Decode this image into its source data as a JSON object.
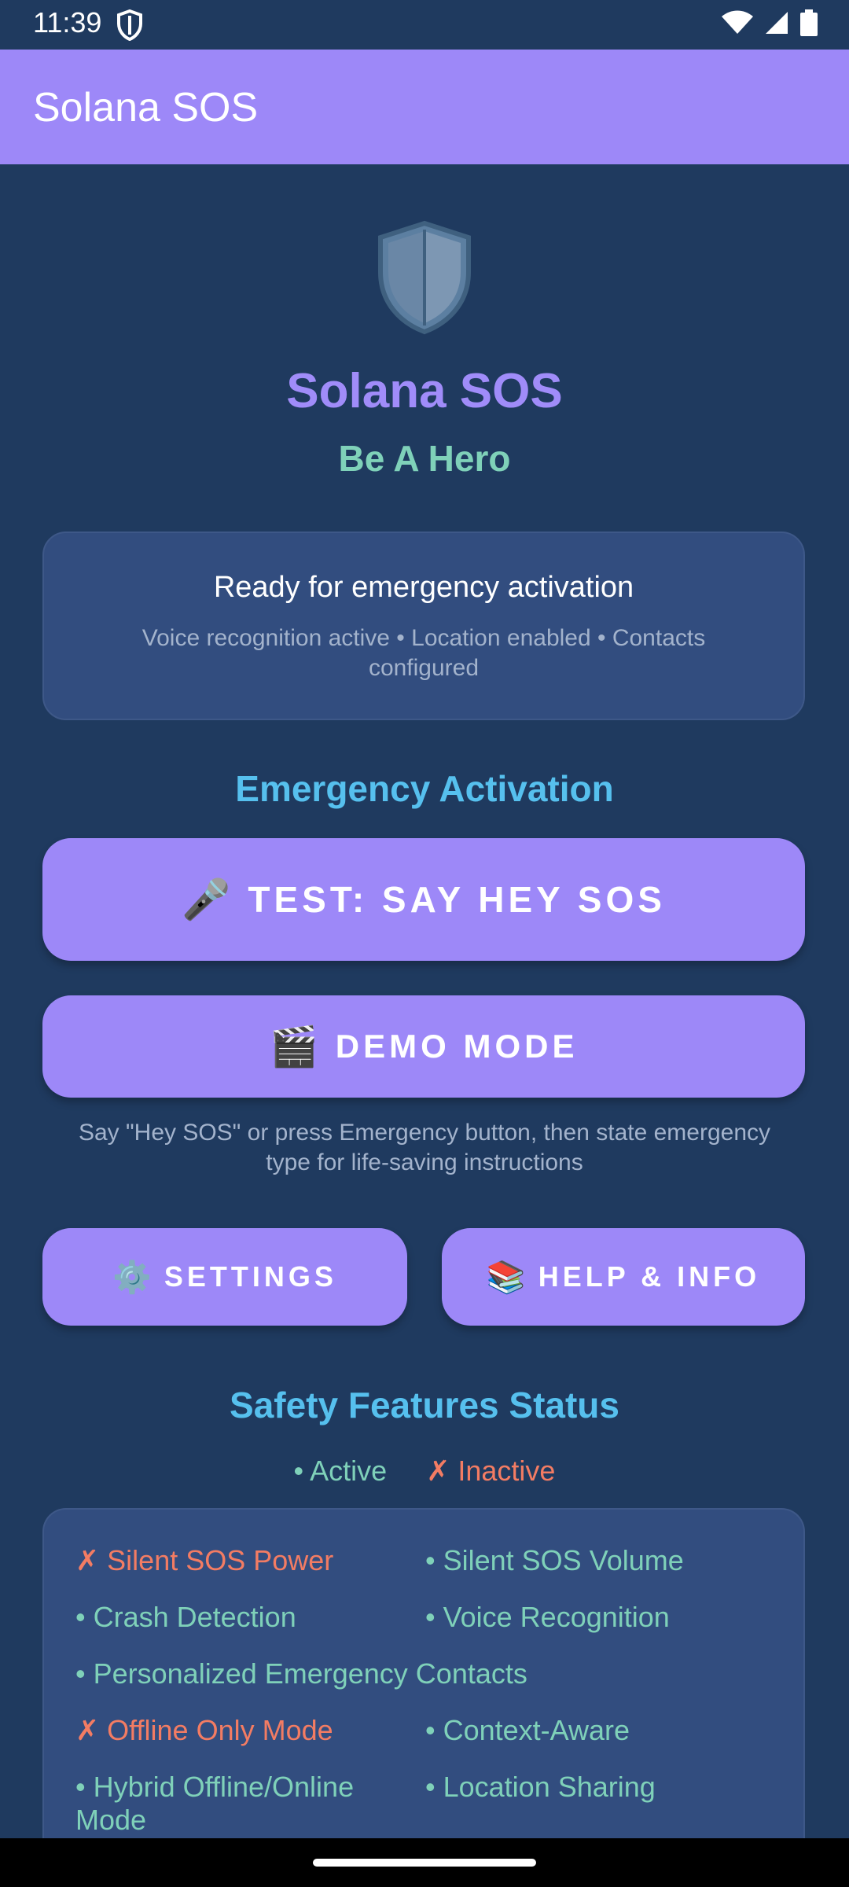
{
  "status_bar": {
    "time": "11:39",
    "icons": [
      "shield-icon",
      "wifi-icon",
      "signal-icon",
      "battery-icon"
    ]
  },
  "app_bar": {
    "title": "Solana SOS"
  },
  "hero": {
    "icon": "shield-icon",
    "title": "Solana SOS",
    "subtitle": "Be A Hero"
  },
  "status_card": {
    "headline": "Ready for emergency activation",
    "detail": "Voice recognition active • Location enabled • Contacts configured"
  },
  "emergency": {
    "section_title": "Emergency Activation",
    "test_icon": "🎤",
    "test_label": "TEST: SAY HEY SOS",
    "demo_icon": "🎬",
    "demo_label": "DEMO MODE",
    "hint": "Say \"Hey SOS\" or press Emergency button, then state emergency type for life-saving instructions"
  },
  "actions": {
    "settings_icon": "⚙️",
    "settings_label": "SETTINGS",
    "help_icon": "📚",
    "help_label": "HELP & INFO"
  },
  "safety": {
    "section_title": "Safety Features Status",
    "legend_active": "• Active",
    "legend_inactive": "✗ Inactive",
    "features": [
      {
        "label": "✗ Silent SOS Power",
        "status": "inactive"
      },
      {
        "label": "• Silent SOS Volume",
        "status": "active"
      },
      {
        "label": "• Crash Detection",
        "status": "active"
      },
      {
        "label": "• Voice Recognition",
        "status": "active"
      },
      {
        "label": "• Personalized Emergency Contacts",
        "status": "active"
      },
      {
        "label": "✗ Offline Only Mode",
        "status": "inactive"
      },
      {
        "label": "• Context-Aware",
        "status": "active"
      },
      {
        "label": "• Hybrid Offline/Online Mode",
        "status": "active"
      },
      {
        "label": "• Location Sharing",
        "status": "active"
      }
    ]
  },
  "colors": {
    "background": "#1f3a5f",
    "accent": "#9d88f8",
    "active": "#7fd1b9",
    "inactive": "#f37c63",
    "section_title": "#56c0ee"
  }
}
